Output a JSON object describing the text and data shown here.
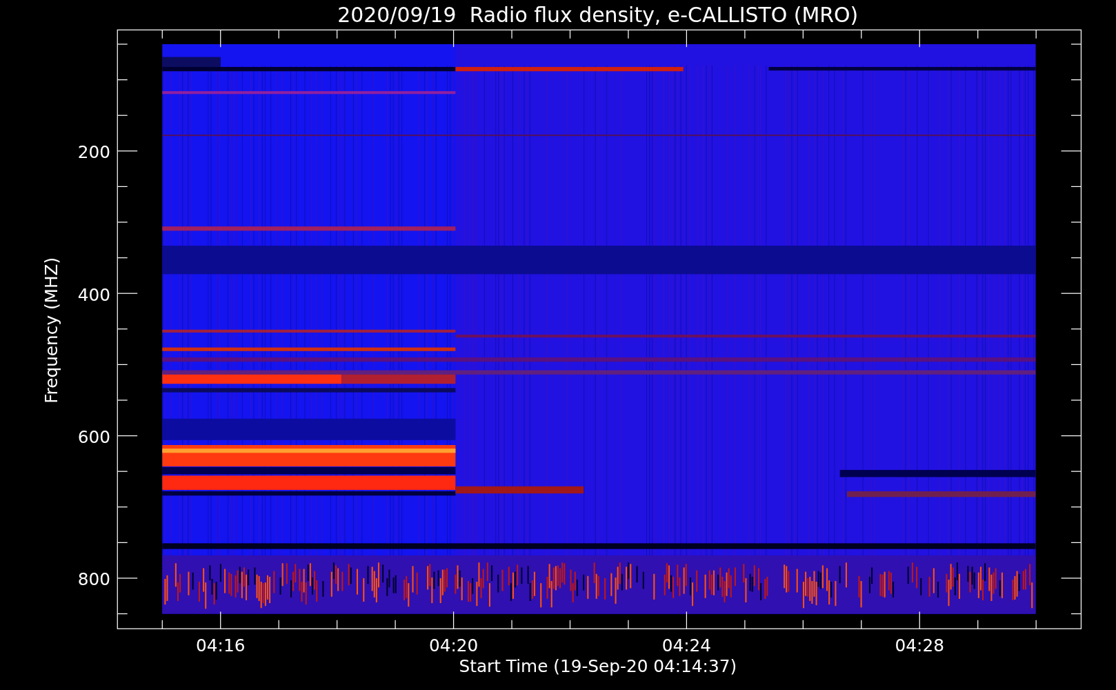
{
  "title": "2020/09/19  Radio flux density, e-CALLISTO (MRO)",
  "y_axis": {
    "label": "Frequency (MHZ)",
    "tick_labels": [
      "200",
      "400",
      "600",
      "800"
    ]
  },
  "x_axis": {
    "label": "Start Time (19-Sep-20 04:14:37)",
    "tick_labels": [
      "04:16",
      "04:20",
      "04:24",
      "04:28"
    ]
  }
}
